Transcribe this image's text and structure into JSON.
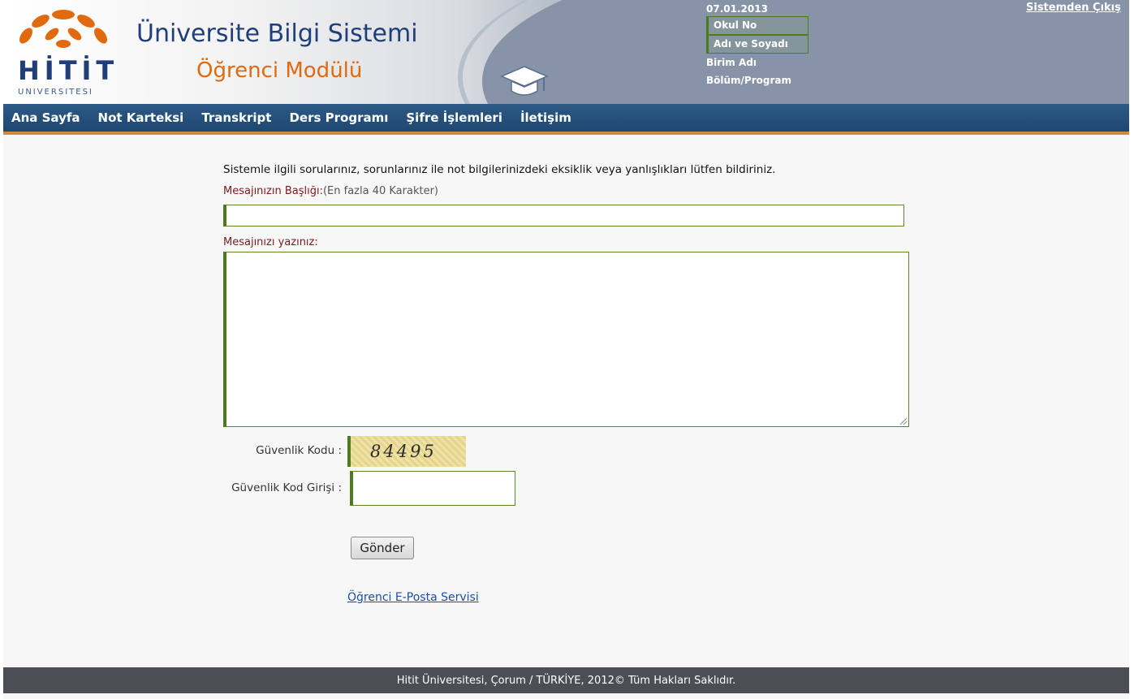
{
  "header": {
    "logo_text": "HİTİT",
    "logo_sub": "UNIVERSITESI",
    "title": "Üniversite Bilgi Sistemi",
    "subtitle": "Öğrenci Modülü",
    "date": "07.01.2013",
    "fields": [
      "Okul No",
      "Adı ve Soyadı",
      "Birim Adı",
      "Bölüm/Program"
    ],
    "logout": "Sistemden Çıkış"
  },
  "nav": {
    "items": [
      "Ana Sayfa",
      "Not Karteksi",
      "Transkript",
      "Ders Programı",
      "Şifre İşlemleri",
      "İletişim"
    ]
  },
  "form": {
    "intro": "Sistemle ilgili sorularınız, sorunlarınız ile  not bilgilerinizdeki eksiklik veya yanlışlıkları  lütfen bildiriniz.",
    "title_label": "Mesajınızın  Başlığı:",
    "title_hint": "(En fazla 40 Karakter)",
    "title_value": "",
    "message_label": "Mesajınızı yazınız:",
    "message_value": "",
    "code_label": "Güvenlik Kodu :",
    "captcha": "84495",
    "code_input_label": "Güvenlik Kod Girişi :",
    "code_value": "",
    "send_button": "Gönder",
    "mail_link": "Öğrenci E-Posta Servisi"
  },
  "footer": {
    "text": "Hitit Üniversitesi, Çorum / TÜRKİYE, 2012© Tüm Hakları Saklıdır."
  },
  "colors": {
    "nav_bg": "#1f4770",
    "accent_green": "#4d7a1f",
    "title_blue": "#1f3e7a",
    "subtitle_orange": "#e06a10",
    "footer_bg": "#4b4e55"
  }
}
